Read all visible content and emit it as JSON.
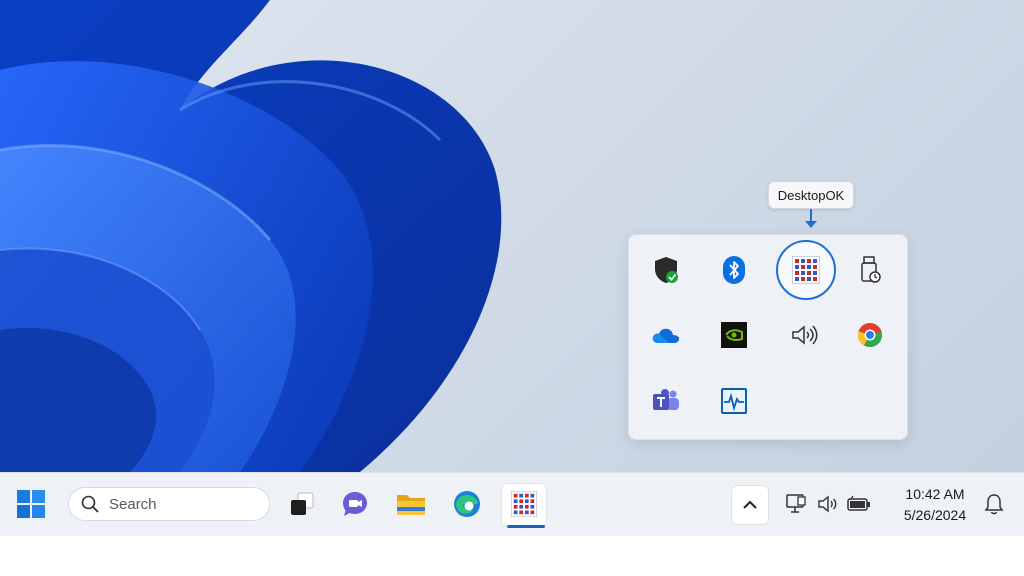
{
  "tooltip": {
    "text": "DesktopOK"
  },
  "taskbar": {
    "search": {
      "placeholder": "Search"
    },
    "clock": {
      "time": "10:42 AM",
      "date": "5/26/2024"
    }
  },
  "flyout_icons": [
    "windows-security-icon",
    "bluetooth-icon",
    "desktopok-icon",
    "usb-safely-remove-icon",
    "onedrive-icon",
    "nvidia-icon",
    "speaker-icon",
    "chrome-icon",
    "teams-icon",
    "resource-monitor-icon"
  ],
  "colors": {
    "accent": "#1f6fd6",
    "taskbar_bg": "#eef1f6"
  }
}
